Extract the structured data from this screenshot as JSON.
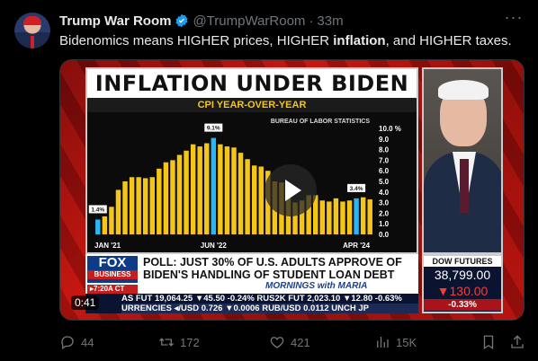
{
  "tweet": {
    "author_name": "Trump War Room",
    "handle": "@TrumpWarRoom",
    "separator": "·",
    "time": "33m",
    "more_icon": "more-icon",
    "text_plain_1": "Bidenomics means HIGHER prices, HIGHER ",
    "text_bold": "inflation",
    "text_plain_2": ", and HIGHER taxes."
  },
  "media": {
    "chart_title": "INFLATION UNDER BIDEN",
    "chart_subtitle": "CPI YEAR-OVER-YEAR",
    "source_label": "BUREAU OF LABOR STATISTICS",
    "poll_line1": "POLL: JUST 30% OF U.S. ADULTS APPROVE OF",
    "poll_line2": "BIDEN'S HANDLING OF STUDENT LOAN DEBT",
    "logo_top": "FOX",
    "logo_bottom": "BUSINESS",
    "timestamp": "▸7:20A CT",
    "show_name": "MORNINGS with MARIA",
    "futures_label": "DOW FUTURES",
    "futures_value": "38,799.00",
    "futures_change": "▼130.00",
    "futures_pct": "-0.33%",
    "ticker_row1": "AS FUT  19,064.25 ▼45.50 -0.24%  RUS2K FUT  2,023.10 ▼12.80 -0.63%",
    "ticker_row2": "URRENCIES  ◂/USD  0.726 ▼0.0006  RUB/USD  0.0112  UNCH  JP",
    "duration": "0:41"
  },
  "chart_data": {
    "type": "bar",
    "title": "INFLATION UNDER BIDEN",
    "subtitle": "CPI YEAR-OVER-YEAR",
    "x_tick_labels": [
      "JAN '21",
      "JUN '22",
      "APR '24"
    ],
    "y_tick_labels": [
      "0.0",
      "1.0",
      "2.0",
      "3.0",
      "4.0",
      "5.0",
      "6.0",
      "7.0",
      "8.0",
      "9.0",
      "10.0 %"
    ],
    "ylim": [
      0,
      10
    ],
    "annotations": [
      {
        "label": "1.4%",
        "index": 0
      },
      {
        "label": "9.1%",
        "index": 17
      },
      {
        "label": "3.4%",
        "index": 38
      }
    ],
    "highlight_color": "#29b6f6",
    "bar_color": "#f5c518",
    "values": [
      1.4,
      1.7,
      2.6,
      4.2,
      5.0,
      5.4,
      5.4,
      5.3,
      5.4,
      6.2,
      6.8,
      7.0,
      7.5,
      7.9,
      8.5,
      8.3,
      8.6,
      9.1,
      8.5,
      8.3,
      8.2,
      7.7,
      7.1,
      6.5,
      6.4,
      6.0,
      5.0,
      4.9,
      4.0,
      3.0,
      3.2,
      3.7,
      3.7,
      3.2,
      3.1,
      3.4,
      3.1,
      3.2,
      3.4,
      3.5,
      3.3
    ]
  },
  "actions": {
    "reply_count": "44",
    "retweet_count": "172",
    "like_count": "421",
    "views_count": "15K"
  }
}
